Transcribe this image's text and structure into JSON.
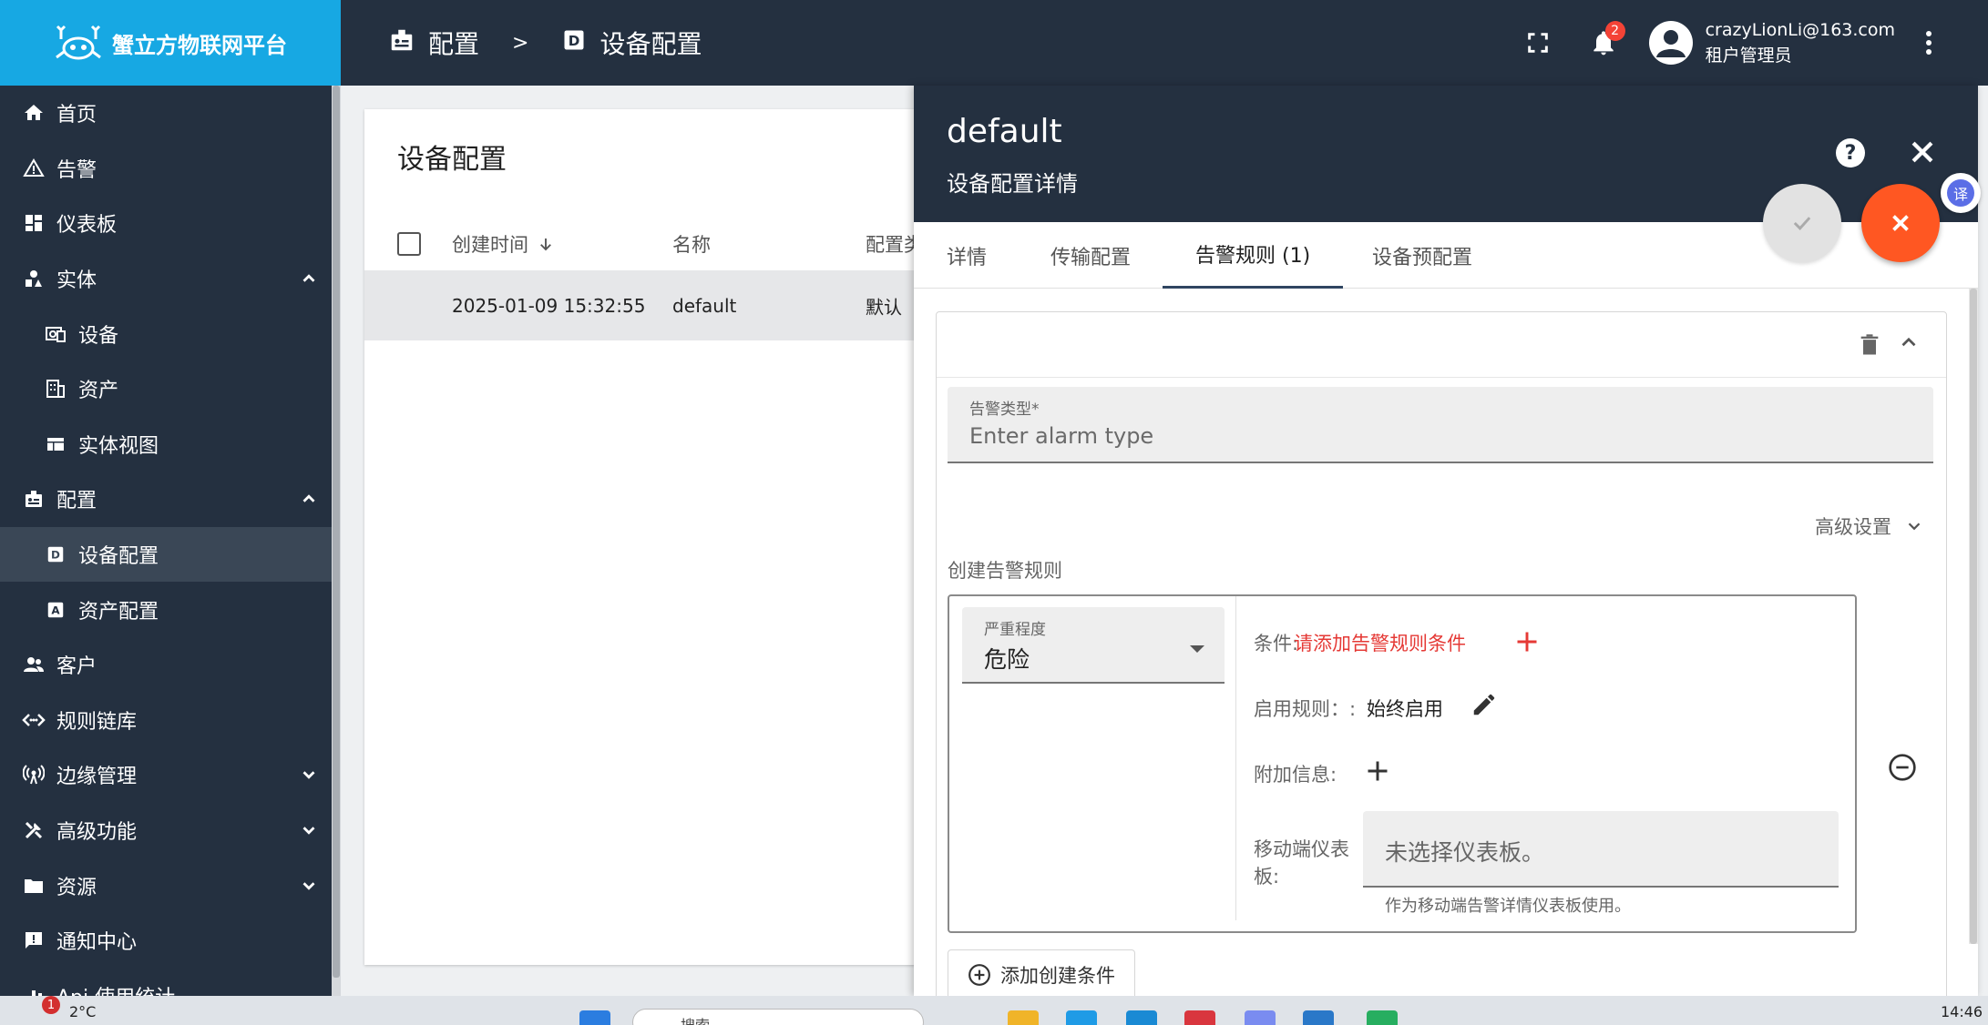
{
  "app": {
    "title": "蟹立方物联网平台"
  },
  "sidebar": {
    "items": [
      {
        "label": "首页",
        "icon": "home-icon"
      },
      {
        "label": "告警",
        "icon": "warning-icon"
      },
      {
        "label": "仪表板",
        "icon": "dashboard-icon"
      },
      {
        "label": "实体",
        "icon": "entity-icon",
        "expanded": true
      },
      {
        "label": "设备",
        "icon": "device-icon"
      },
      {
        "label": "资产",
        "icon": "asset-icon"
      },
      {
        "label": "实体视图",
        "icon": "entity-view-icon"
      },
      {
        "label": "配置",
        "icon": "profile-icon",
        "expanded": true
      },
      {
        "label": "设备配置",
        "icon": "device-profile-icon",
        "active": true
      },
      {
        "label": "资产配置",
        "icon": "asset-profile-icon"
      },
      {
        "label": "客户",
        "icon": "customers-icon"
      },
      {
        "label": "规则链库",
        "icon": "rule-chain-icon"
      },
      {
        "label": "边缘管理",
        "icon": "edge-icon",
        "collapsed": true
      },
      {
        "label": "高级功能",
        "icon": "tools-icon",
        "collapsed": true
      },
      {
        "label": "资源",
        "icon": "folder-icon",
        "collapsed": true
      },
      {
        "label": "通知中心",
        "icon": "notification-center-icon"
      },
      {
        "label": "Api 使用统计",
        "icon": "api-usage-icon"
      }
    ]
  },
  "header": {
    "breadcrumb": [
      {
        "label": "配置",
        "icon": "profile-icon"
      },
      {
        "separator": ">"
      },
      {
        "label": "设备配置",
        "icon": "device-profile-icon"
      }
    ],
    "notification_count": "2",
    "user_email": "crazyLionLi@163.com",
    "user_role": "租户管理员"
  },
  "main": {
    "title": "设备配置",
    "columns": [
      "创建时间",
      "名称",
      "配置类"
    ],
    "rows": [
      {
        "created": "2025-01-09 15:32:55",
        "name": "default",
        "type": "默认"
      }
    ]
  },
  "panel": {
    "title": "default",
    "subtitle": "设备配置详情",
    "help": "?",
    "tabs": [
      "详情",
      "传输配置",
      "告警规则 (1)",
      "设备预配置"
    ],
    "active_tab": "告警规则 (1)",
    "alarm_type_label": "告警类型*",
    "alarm_type_placeholder": "Enter alarm type",
    "advanced_label": "高级设置",
    "create_rule_label": "创建告警规则",
    "severity_label": "严重程度",
    "severity_value": "危险",
    "condition_label": "条件:",
    "condition_add": "请添加告警规则条件",
    "schedule_label": "启用规则：:",
    "schedule_value": "始终启用",
    "extra_label": "附加信息:",
    "mobile_label_1": "移动端仪表",
    "mobile_label_2": "板:",
    "mobile_placeholder": "未选择仪表板。",
    "mobile_hint": "作为移动端告警详情仪表板使用。",
    "add_condition": "添加创建条件"
  },
  "translate_glyph": "译",
  "taskbar": {
    "temperature": "2°C",
    "badge": "1",
    "time": "14:46",
    "search": "搜索"
  },
  "colors": {
    "sidebar": "#243040",
    "logo": "#17a8e3",
    "accent_fab": "#ff5722",
    "danger": "#e53935"
  }
}
